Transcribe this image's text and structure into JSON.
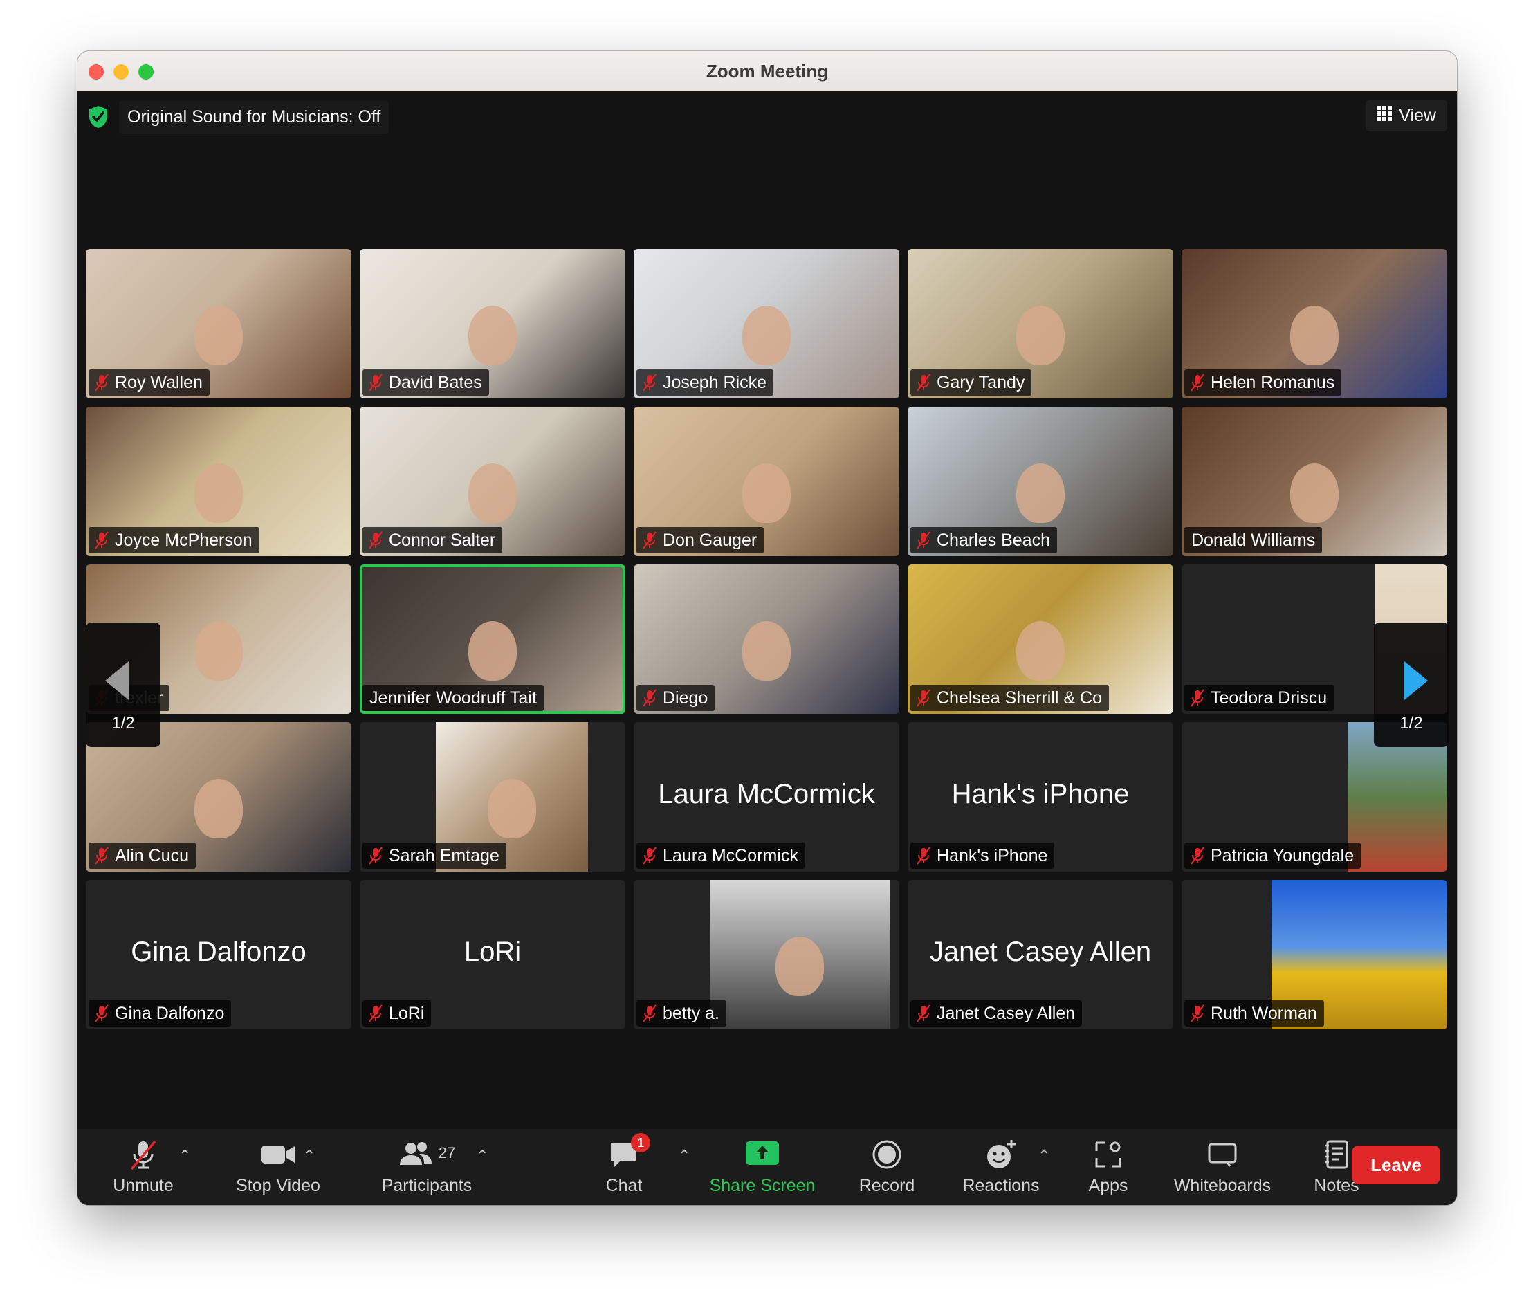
{
  "window": {
    "title": "Zoom Meeting"
  },
  "top_bar": {
    "sound_status": "Original Sound for Musicians: Off",
    "view_label": "View"
  },
  "pagination": {
    "page_left": "1/2",
    "page_right": "1/2"
  },
  "participants": [
    {
      "name": "Roy Wallen",
      "muted": true,
      "video": true
    },
    {
      "name": "David Bates",
      "muted": true,
      "video": true
    },
    {
      "name": "Joseph Ricke",
      "muted": true,
      "video": true
    },
    {
      "name": "Gary Tandy",
      "muted": true,
      "video": true
    },
    {
      "name": "Helen Romanus",
      "muted": true,
      "video": true
    },
    {
      "name": "Joyce McPherson",
      "muted": true,
      "video": true
    },
    {
      "name": "Connor Salter",
      "muted": true,
      "video": true
    },
    {
      "name": "Don Gauger",
      "muted": true,
      "video": true
    },
    {
      "name": "Charles Beach",
      "muted": true,
      "video": true
    },
    {
      "name": "Donald Williams",
      "muted": false,
      "video": true
    },
    {
      "name": "trexler",
      "muted": true,
      "video": true
    },
    {
      "name": "Jennifer Woodruff Tait",
      "muted": false,
      "video": true,
      "active_speaker": true
    },
    {
      "name": "Diego",
      "muted": true,
      "video": true
    },
    {
      "name": "Chelsea Sherrill & Co",
      "muted": true,
      "video": true
    },
    {
      "name": "Teodora Driscu",
      "muted": true,
      "video": true
    },
    {
      "name": "Alin Cucu",
      "muted": true,
      "video": true
    },
    {
      "name": "Sarah Emtage",
      "muted": true,
      "video": true
    },
    {
      "name": "Laura McCormick",
      "muted": true,
      "video": false,
      "display_name": "Laura McCormick"
    },
    {
      "name": "Hank's iPhone",
      "muted": true,
      "video": false,
      "display_name": "Hank's iPhone"
    },
    {
      "name": "Patricia Youngdale",
      "muted": true,
      "video": true
    },
    {
      "name": "Gina Dalfonzo",
      "muted": true,
      "video": false,
      "display_name": "Gina Dalfonzo"
    },
    {
      "name": "LoRi",
      "muted": true,
      "video": false,
      "display_name": "LoRi"
    },
    {
      "name": "betty a.",
      "muted": true,
      "video": true
    },
    {
      "name": "Janet Casey Allen",
      "muted": true,
      "video": false,
      "display_name": "Janet Casey Allen"
    },
    {
      "name": "Ruth Worman",
      "muted": true,
      "video": true
    }
  ],
  "toolbar": {
    "unmute": "Unmute",
    "stop_video": "Stop Video",
    "participants": "Participants",
    "participants_count": "27",
    "chat": "Chat",
    "chat_badge": "1",
    "share_screen": "Share Screen",
    "record": "Record",
    "reactions": "Reactions",
    "apps": "Apps",
    "whiteboards": "Whiteboards",
    "notes": "Notes",
    "leave": "Leave"
  },
  "colors": {
    "accent_green": "#2dc653",
    "leave_red": "#e02828",
    "muted_red": "#e0262b",
    "pager_arrow_blue": "#2aa8f0"
  },
  "icons": [
    "shield-check-icon",
    "grid-view-icon",
    "muted-mic-icon",
    "video-camera-icon",
    "participants-icon",
    "chat-bubble-icon",
    "share-screen-arrow-icon",
    "record-icon",
    "emoji-plus-icon",
    "apps-icon",
    "whiteboard-icon",
    "notes-icon",
    "chevron-left-icon",
    "chevron-right-icon"
  ]
}
